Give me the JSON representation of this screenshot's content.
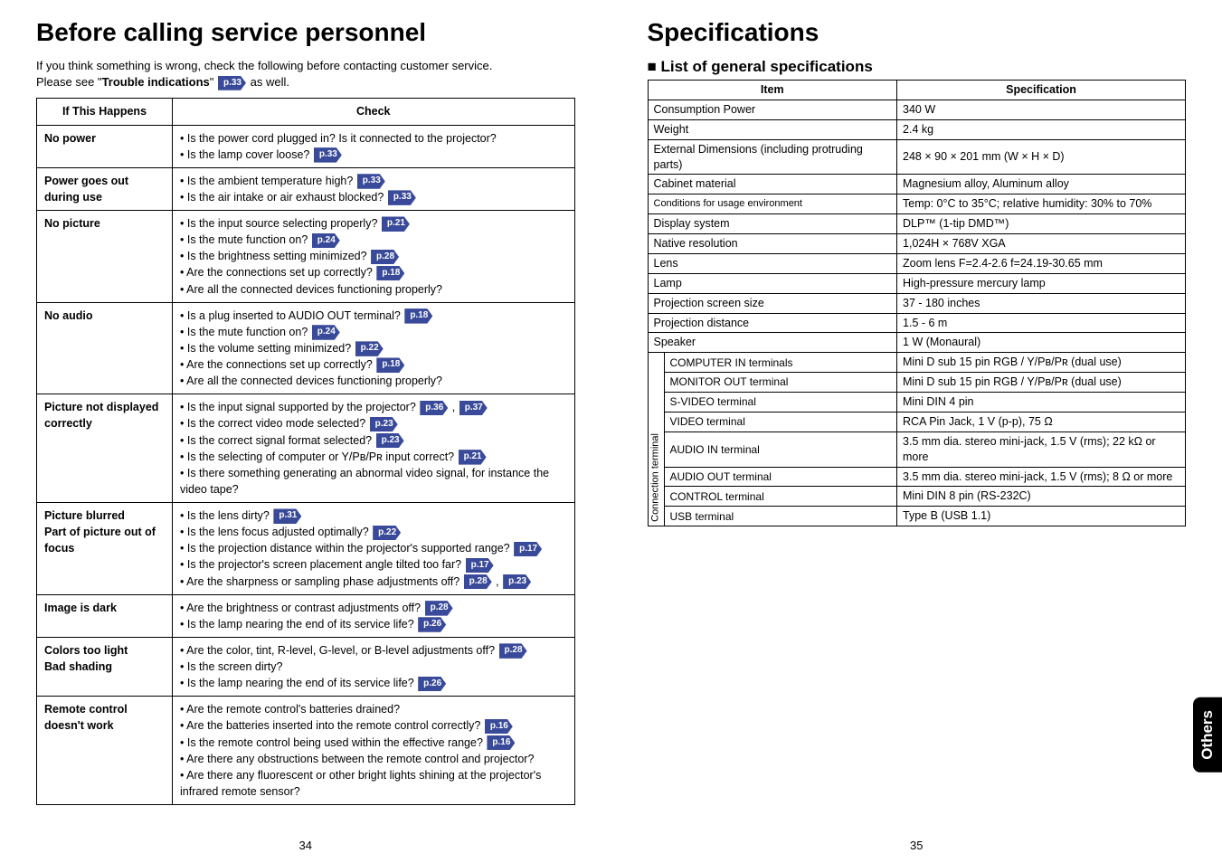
{
  "leftPage": {
    "title": "Before calling service personnel",
    "intro1": "If you think something is wrong, check the following before contacting customer service.",
    "intro2a": "Please see \"",
    "intro2b": "Trouble indications",
    "intro2c": "\" ",
    "intro2ref": "p.33",
    "intro2d": " as well.",
    "headers": {
      "col1": "If  This Happens",
      "col2": "Check"
    },
    "rows": [
      {
        "issue": "No power",
        "checks": [
          {
            "text": "Is the power cord plugged in? Is it connected to the projector?"
          },
          {
            "text": "Is the lamp cover loose? ",
            "refs": [
              "p.33"
            ]
          }
        ]
      },
      {
        "issue": "Power goes out during use",
        "checks": [
          {
            "text": "Is the ambient temperature high? ",
            "refs": [
              "p.33"
            ]
          },
          {
            "text": "Is the air intake or air exhaust blocked? ",
            "refs": [
              "p.33"
            ]
          }
        ]
      },
      {
        "issue": "No picture",
        "checks": [
          {
            "text": "Is the input source selecting properly? ",
            "refs": [
              "p.21"
            ]
          },
          {
            "text": "Is the mute function on? ",
            "refs": [
              "p.24"
            ]
          },
          {
            "text": "Is the brightness setting minimized? ",
            "refs": [
              "p.28"
            ]
          },
          {
            "text": "Are the connections set up correctly? ",
            "refs": [
              "p.18"
            ]
          },
          {
            "text": "Are all the connected devices functioning properly?"
          }
        ]
      },
      {
        "issue": "No audio",
        "checks": [
          {
            "text": "Is a plug inserted to AUDIO OUT terminal? ",
            "refs": [
              "p.18"
            ]
          },
          {
            "text": "Is the mute function on? ",
            "refs": [
              "p.24"
            ]
          },
          {
            "text": "Is the volume setting minimized? ",
            "refs": [
              "p.22"
            ]
          },
          {
            "text": "Are the connections set up correctly? ",
            "refs": [
              "p.18"
            ]
          },
          {
            "text": "Are all the connected devices functioning properly?"
          }
        ]
      },
      {
        "issue": "Picture not displayed correctly",
        "checks": [
          {
            "text": "Is the input signal supported by the projector? ",
            "refs": [
              "p.36",
              "p.37"
            ]
          },
          {
            "text": "Is the correct video mode selected? ",
            "refs": [
              "p.23"
            ]
          },
          {
            "text": "Is the correct signal format selected?  ",
            "refs": [
              "p.23"
            ]
          },
          {
            "text": "Is the selecting of computer or Y/Pʙ/Pʀ input correct? ",
            "refs": [
              "p.21"
            ]
          },
          {
            "text": "Is there something generating an abnormal video signal, for instance the video tape?"
          }
        ]
      },
      {
        "issue": "Picture blurred\nPart of picture out of focus",
        "checks": [
          {
            "text": "Is the lens dirty? ",
            "refs": [
              "p.31"
            ]
          },
          {
            "text": "Is the lens focus adjusted optimally? ",
            "refs": [
              "p.22"
            ]
          },
          {
            "text": "Is the projection distance within the projector's supported range? ",
            "refs": [
              "p.17"
            ]
          },
          {
            "text": "Is the projector's screen placement angle tilted too far?  ",
            "refs": [
              "p.17"
            ]
          },
          {
            "text": "Are the sharpness or sampling phase adjustments off? ",
            "refs": [
              "p.28",
              "p.23"
            ]
          }
        ]
      },
      {
        "issue": "Image is dark",
        "checks": [
          {
            "text": "Are the brightness or contrast adjustments off? ",
            "refs": [
              "p.28"
            ]
          },
          {
            "text": "Is the lamp nearing the end of its service life? ",
            "refs": [
              "p.26"
            ]
          }
        ]
      },
      {
        "issue": "Colors too light\nBad shading",
        "checks": [
          {
            "text": "Are the color, tint, R-level, G-level, or B-level adjustments off? ",
            "refs": [
              "p.28"
            ]
          },
          {
            "text": "Is the screen dirty?"
          },
          {
            "text": "Is the lamp nearing the end of its service life? ",
            "refs": [
              "p.26"
            ]
          }
        ]
      },
      {
        "issue": "Remote control doesn't work",
        "checks": [
          {
            "text": "Are the remote control's batteries drained?"
          },
          {
            "text": "Are the batteries inserted into the remote control correctly? ",
            "refs": [
              "p.16"
            ]
          },
          {
            "text": "Is the remote control being used within the effective range? ",
            "refs": [
              "p.16"
            ]
          },
          {
            "text": "Are there any obstructions between the remote control and projector?"
          },
          {
            "text": "Are there any fluorescent or other bright lights shining at the projector's infrared remote sensor?"
          }
        ]
      }
    ],
    "pageNum": "34"
  },
  "rightPage": {
    "title": "Specifications",
    "subhead": "List of general specifications",
    "headers": {
      "col1": "Item",
      "col2": "Specification"
    },
    "rows": [
      {
        "item": "Consumption Power",
        "spec": "340 W"
      },
      {
        "item": "Weight",
        "spec": "2.4 kg"
      },
      {
        "item": "External Dimensions (including protruding parts)",
        "spec": "248 × 90 × 201 mm (W × H × D)"
      },
      {
        "item": "Cabinet material",
        "spec": "Magnesium alloy, Aluminum alloy"
      },
      {
        "item": "Conditions for usage environment",
        "spec": "Temp: 0°C to 35°C; relative humidity: 30% to 70%",
        "small": true
      },
      {
        "item": "Display system",
        "spec": "DLP™ (1-tip DMD™)"
      },
      {
        "item": "Native resolution",
        "spec": "1,024H × 768V  XGA"
      },
      {
        "item": "Lens",
        "spec": "Zoom lens F=2.4-2.6   f=24.19-30.65 mm"
      },
      {
        "item": "Lamp",
        "spec": "High-pressure mercury lamp"
      },
      {
        "item": "Projection screen size",
        "spec": "37 - 180 inches"
      },
      {
        "item": "Projection distance",
        "spec": "1.5 - 6 m"
      },
      {
        "item": "Speaker",
        "spec": "1 W (Monaural)"
      }
    ],
    "connLabel": "Connection terminal",
    "connRows": [
      {
        "item": "COMPUTER IN terminals",
        "spec": "Mini D sub 15 pin   RGB / Y/Pʙ/Pʀ (dual use)"
      },
      {
        "item": "MONITOR OUT terminal",
        "spec": "Mini D sub 15 pin   RGB / Y/Pʙ/Pʀ (dual use)"
      },
      {
        "item": "S-VIDEO terminal",
        "spec": "Mini DIN 4 pin"
      },
      {
        "item": "VIDEO terminal",
        "spec": "RCA Pin Jack, 1 V (p-p), 75 Ω"
      },
      {
        "item": "AUDIO IN terminal",
        "spec": "3.5 mm dia. stereo mini-jack, 1.5 V (rms); 22 kΩ or more"
      },
      {
        "item": "AUDIO OUT terminal",
        "spec": "3.5 mm dia. stereo mini-jack, 1.5 V (rms); 8 Ω or more"
      },
      {
        "item": "CONTROL terminal",
        "spec": "Mini DIN 8 pin (RS-232C)"
      },
      {
        "item": "USB terminal",
        "spec": "Type B (USB 1.1)"
      }
    ],
    "pageNum": "35",
    "sideTab": "Others"
  }
}
